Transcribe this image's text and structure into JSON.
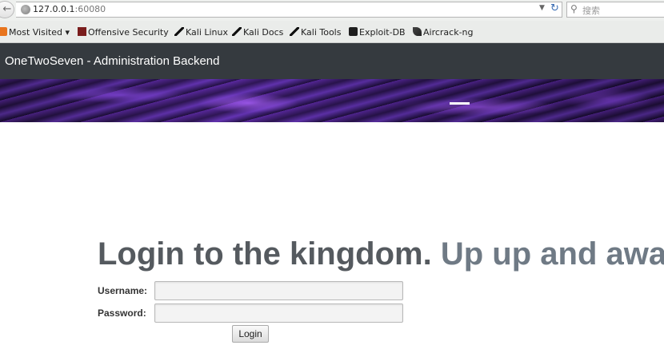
{
  "browser": {
    "url_host": "127.0.0.1",
    "url_port": ":60080",
    "search_placeholder": "搜索",
    "bookmarks": [
      {
        "label": "Most Visited ▾",
        "icon": "rss-icon"
      },
      {
        "label": "Offensive Security",
        "icon": "offsec-icon"
      },
      {
        "label": "Kali Linux",
        "icon": "kali-dragon-icon"
      },
      {
        "label": "Kali Docs",
        "icon": "kali-dragon-icon"
      },
      {
        "label": "Kali Tools",
        "icon": "kali-dragon-icon"
      },
      {
        "label": "Exploit-DB",
        "icon": "exploit-db-icon"
      },
      {
        "label": "Aircrack-ng",
        "icon": "aircrack-icon"
      }
    ]
  },
  "site": {
    "brand": "OneTwoSeven - Administration Backend",
    "colors": {
      "navbar": "#353a3f",
      "banner_accent": "#5a2b9e"
    }
  },
  "login": {
    "heading_main": "Login to the kingdom.",
    "heading_sub": "Up up and away!",
    "username_label": "Username:",
    "password_label": "Password:",
    "username_value": "",
    "password_value": "",
    "submit_label": "Login"
  }
}
